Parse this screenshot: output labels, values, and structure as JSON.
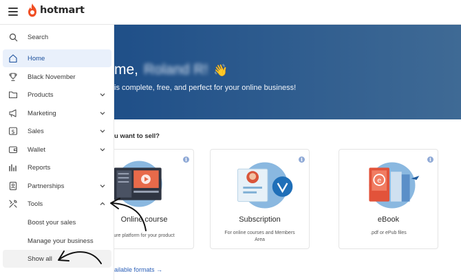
{
  "header": {
    "brand": "hotmart",
    "menu_icon": "hamburger-icon"
  },
  "sidebar": {
    "items": [
      {
        "label": "Search",
        "icon": "search-icon"
      },
      {
        "label": "Home",
        "icon": "home-icon",
        "active": true
      },
      {
        "label": "Black November",
        "icon": "trophy-icon"
      },
      {
        "label": "Products",
        "icon": "folder-icon",
        "expandable": true
      },
      {
        "label": "Marketing",
        "icon": "megaphone-icon",
        "expandable": true
      },
      {
        "label": "Sales",
        "icon": "dollar-icon",
        "expandable": true
      },
      {
        "label": "Wallet",
        "icon": "wallet-icon",
        "expandable": true
      },
      {
        "label": "Reports",
        "icon": "bar-chart-icon"
      },
      {
        "label": "Partnerships",
        "icon": "id-badge-icon",
        "expandable": true
      },
      {
        "label": "Tools",
        "icon": "tools-icon",
        "expanded": true
      }
    ],
    "tools_submenu": [
      "Boost your sales",
      "Manage your business",
      "Show all"
    ]
  },
  "hero": {
    "greeting": "me,",
    "name": "Roland R!",
    "emoji": "👋",
    "subtitle": "is complete, free, and perfect for your online business!"
  },
  "main": {
    "question": "u want to sell?",
    "cards": [
      {
        "title": "Online course",
        "desc": "ure platform for your product"
      },
      {
        "title": "Subscription",
        "desc": "For online courses and Members Area"
      },
      {
        "title": "eBook",
        "desc": ".pdf or ePub files"
      }
    ],
    "formats_link": "ailable formats",
    "formats_arrow": "→"
  },
  "colors": {
    "accent": "#1b4f9c",
    "brand": "#f04e23",
    "hero": "#2a5a8e"
  }
}
